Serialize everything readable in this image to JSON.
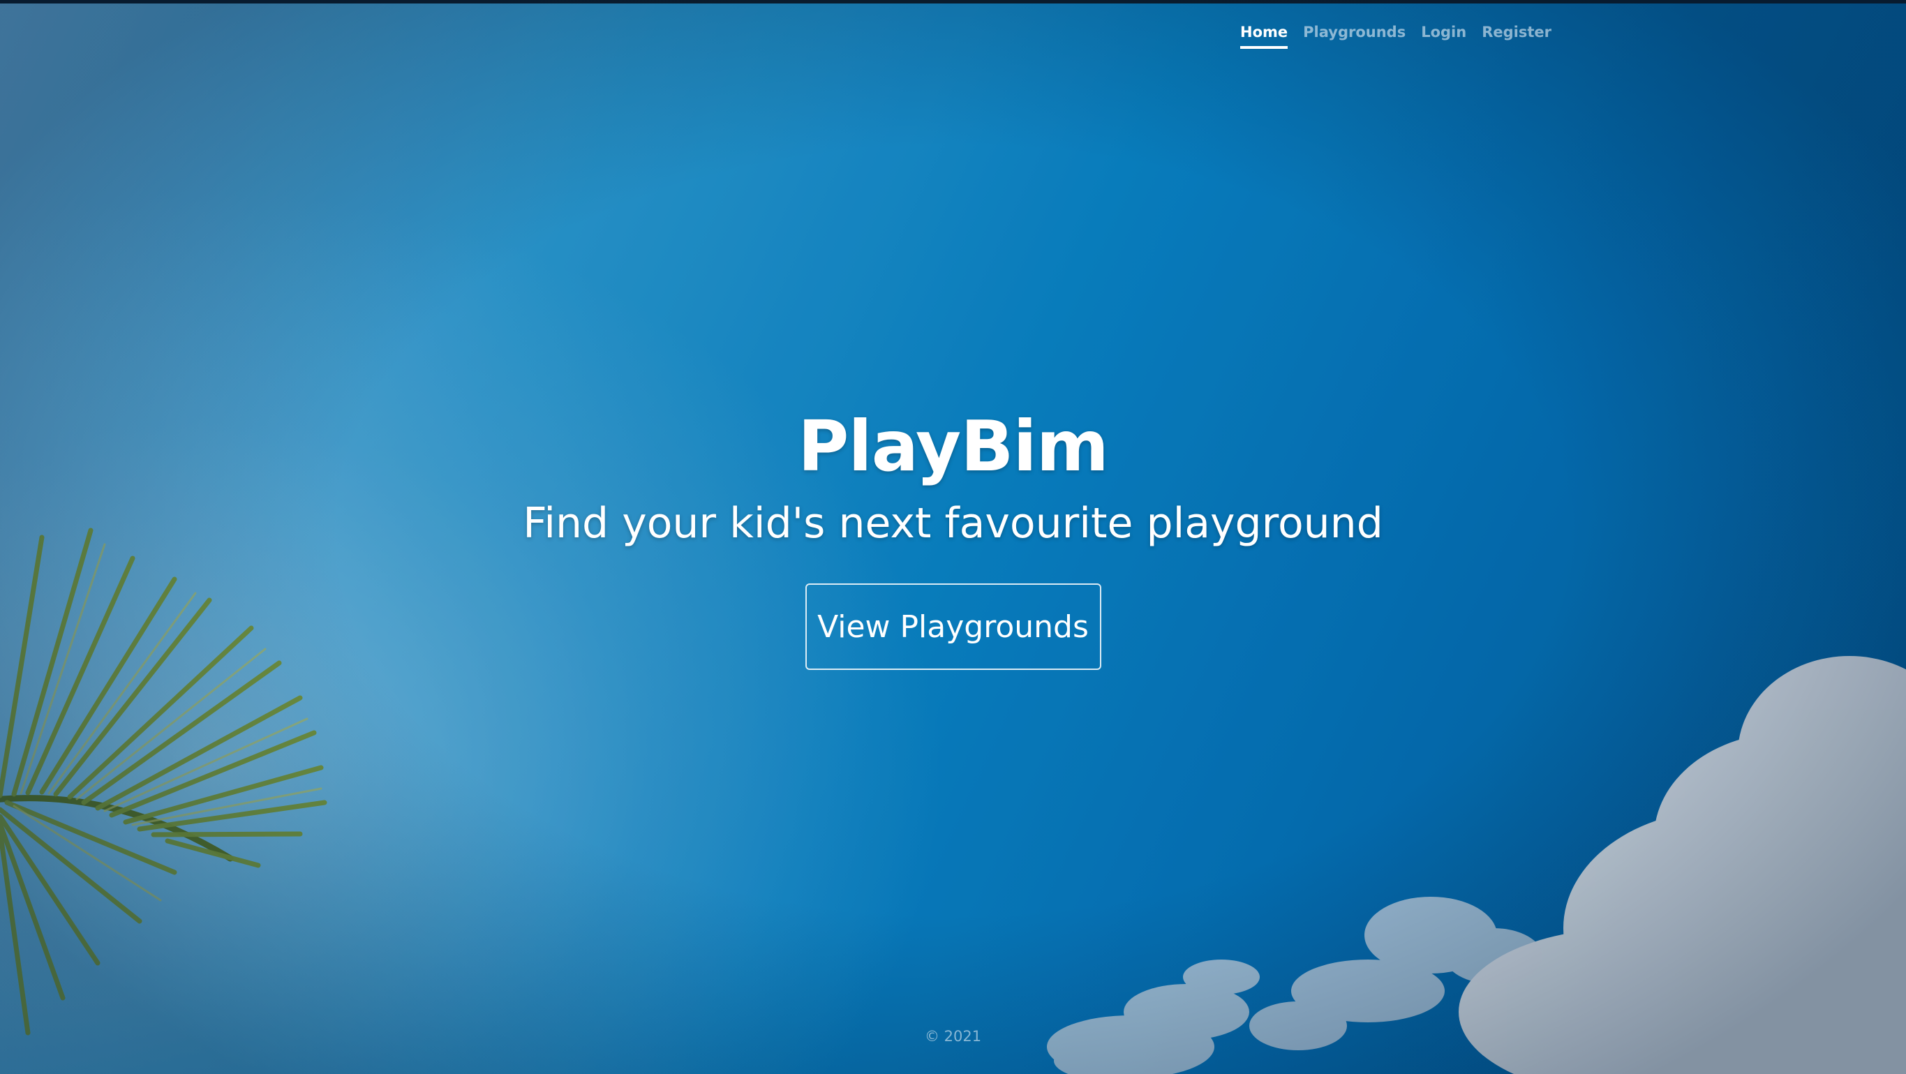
{
  "nav": {
    "items": [
      {
        "label": "Home",
        "active": true
      },
      {
        "label": "Playgrounds",
        "active": false
      },
      {
        "label": "Login",
        "active": false
      },
      {
        "label": "Register",
        "active": false
      }
    ]
  },
  "hero": {
    "title": "PlayBim",
    "subtitle": "Find your kid's next favourite playground",
    "cta_label": "View Playgrounds"
  },
  "footer": {
    "copyright": "© 2021"
  },
  "colors": {
    "sky_blue": "#0a8bd0",
    "text": "#ffffff"
  }
}
